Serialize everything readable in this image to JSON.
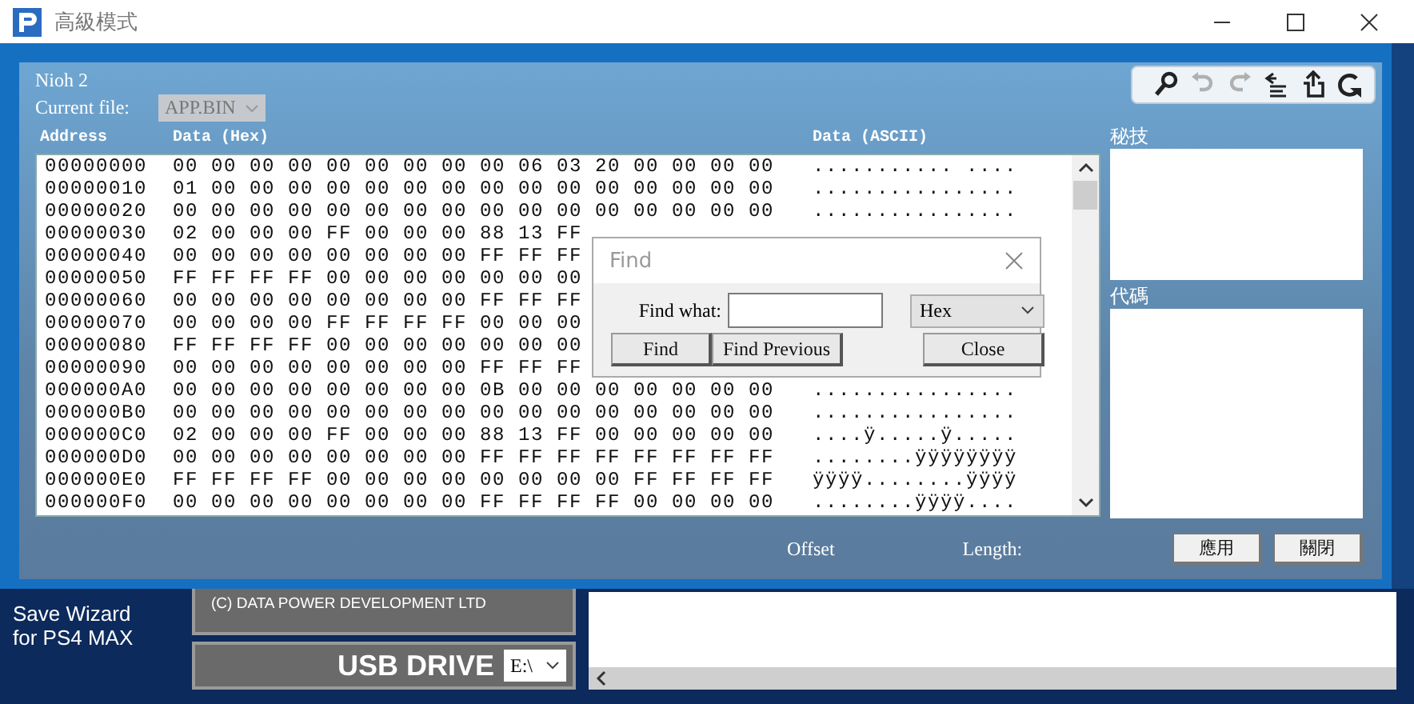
{
  "window": {
    "title": "高級模式"
  },
  "game": "Nioh 2",
  "current_file": {
    "label": "Current file:",
    "value": "APP.BIN",
    "disabled": true
  },
  "toolbar": [
    {
      "kind": "search",
      "disabled": false
    },
    {
      "kind": "undo",
      "disabled": true
    },
    {
      "kind": "redo",
      "disabled": true
    },
    {
      "kind": "align",
      "disabled": false
    },
    {
      "kind": "upload",
      "disabled": false
    },
    {
      "kind": "refresh",
      "disabled": false
    }
  ],
  "hex_view": {
    "columns": [
      "Address",
      "Data (Hex)",
      "Data (ASCII)"
    ],
    "rows": [
      {
        "address": "00000000",
        "hex": "00 00 00 00 00 00 00 00 00 06 03 20 00 00 00 00",
        "ascii": "........... ...."
      },
      {
        "address": "00000010",
        "hex": "01 00 00 00 00 00 00 00 00 00 00 00 00 00 00 00",
        "ascii": "................"
      },
      {
        "address": "00000020",
        "hex": "00 00 00 00 00 00 00 00 00 00 00 00 00 00 00 00",
        "ascii": "................"
      },
      {
        "address": "00000030",
        "hex": "02 00 00 00 FF 00 00 00 88 13 FF"
      },
      {
        "address": "00000040",
        "hex": "00 00 00 00 00 00 00 00 FF FF FF"
      },
      {
        "address": "00000050",
        "hex": "FF FF FF FF 00 00 00 00 00 00 00"
      },
      {
        "address": "00000060",
        "hex": "00 00 00 00 00 00 00 00 FF FF FF"
      },
      {
        "address": "00000070",
        "hex": "00 00 00 00 FF FF FF FF 00 00 00"
      },
      {
        "address": "00000080",
        "hex": "FF FF FF FF 00 00 00 00 00 00 00"
      },
      {
        "address": "00000090",
        "hex": "00 00 00 00 00 00 00 00 FF FF FF"
      },
      {
        "address": "000000A0",
        "hex": "00 00 00 00 00 00 00 00 0B 00 00 00 00 00 00 00",
        "ascii": "................"
      },
      {
        "address": "000000B0",
        "hex": "00 00 00 00 00 00 00 00 00 00 00 00 00 00 00 00",
        "ascii": "................"
      },
      {
        "address": "000000C0",
        "hex": "02 00 00 00 FF 00 00 00 88 13 FF 00 00 00 00 00",
        "ascii": "....ÿ.....ÿ....."
      },
      {
        "address": "000000D0",
        "hex": "00 00 00 00 00 00 00 00 FF FF FF FF FF FF FF FF",
        "ascii": "........ÿÿÿÿÿÿÿÿ"
      },
      {
        "address": "000000E0",
        "hex": "FF FF FF FF 00 00 00 00 00 00 00 00 FF FF FF FF",
        "ascii": "ÿÿÿÿ........ÿÿÿÿ"
      },
      {
        "address": "000000F0",
        "hex": "00 00 00 00 00 00 00 00 FF FF FF FF 00 00 00 00",
        "ascii": "........ÿÿÿÿ...."
      }
    ]
  },
  "cheats_panel": {
    "label": "秘技"
  },
  "code_panel": {
    "label": "代碼"
  },
  "status": {
    "offset_label": "Offset",
    "length_label": "Length:"
  },
  "buttons": [
    "應用",
    "關閉"
  ],
  "find_dialog": {
    "title": "Find",
    "label": "Find what:",
    "mode": "Hex",
    "buttons": [
      "Find",
      "Find Previous",
      "Close"
    ]
  },
  "background_app": {
    "app_name": "Save Wizard for PS4 MAX",
    "copyright": "(C) DATA POWER DEVELOPMENT LTD",
    "drive_label": "USB DRIVE",
    "drive": "E:\\"
  }
}
